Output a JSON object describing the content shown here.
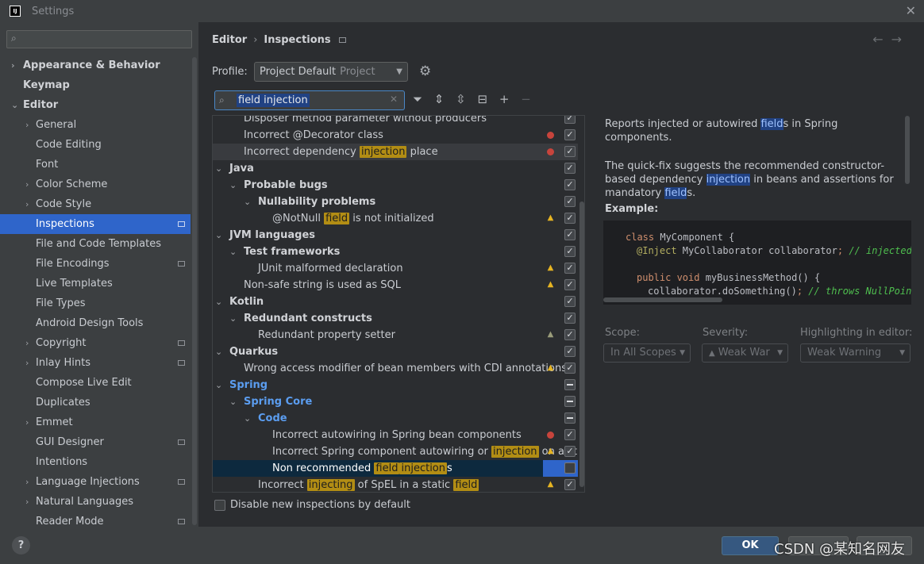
{
  "window": {
    "title": "Settings",
    "logo_text": "IJ"
  },
  "sidebar": {
    "items": [
      {
        "label": "Appearance & Behavior"
      },
      {
        "label": "Keymap"
      },
      {
        "label": "Editor"
      },
      {
        "label": "General"
      },
      {
        "label": "Code Editing"
      },
      {
        "label": "Font"
      },
      {
        "label": "Color Scheme"
      },
      {
        "label": "Code Style"
      },
      {
        "label": "Inspections"
      },
      {
        "label": "File and Code Templates"
      },
      {
        "label": "File Encodings"
      },
      {
        "label": "Live Templates"
      },
      {
        "label": "File Types"
      },
      {
        "label": "Android Design Tools"
      },
      {
        "label": "Copyright"
      },
      {
        "label": "Inlay Hints"
      },
      {
        "label": "Compose Live Edit"
      },
      {
        "label": "Duplicates"
      },
      {
        "label": "Emmet"
      },
      {
        "label": "GUI Designer"
      },
      {
        "label": "Intentions"
      },
      {
        "label": "Language Injections"
      },
      {
        "label": "Natural Languages"
      },
      {
        "label": "Reader Mode"
      }
    ]
  },
  "breadcrumb": {
    "parent": "Editor",
    "current": "Inspections"
  },
  "profile": {
    "label": "Profile:",
    "value": "Project Default",
    "scope": "Project"
  },
  "filter": {
    "value": "field injection"
  },
  "tree": {
    "rows": [
      {
        "pre": "Disposer method parameter without producers"
      },
      {
        "pre": "Incorrect @Decorator class"
      },
      {
        "pre": "Incorrect dependency ",
        "hl": "injection",
        "post": " place"
      },
      {
        "pre": "Java"
      },
      {
        "pre": "Probable bugs"
      },
      {
        "pre": "Nullability problems"
      },
      {
        "pre": "@NotNull ",
        "hl": "field",
        "post": " is not initialized"
      },
      {
        "pre": "JVM languages"
      },
      {
        "pre": "Test frameworks"
      },
      {
        "pre": "JUnit malformed declaration"
      },
      {
        "pre": "Non-safe string is used as SQL"
      },
      {
        "pre": "Kotlin"
      },
      {
        "pre": "Redundant constructs"
      },
      {
        "pre": "Redundant property setter"
      },
      {
        "pre": "Quarkus"
      },
      {
        "pre": "Wrong access modifier of bean members with CDI annotations"
      },
      {
        "pre": "Spring"
      },
      {
        "pre": "Spring Core"
      },
      {
        "pre": "Code"
      },
      {
        "pre": "Incorrect autowiring in Spring bean components"
      },
      {
        "pre": "Incorrect Spring component autowiring or ",
        "hl": "injection",
        "post": " on a st"
      },
      {
        "pre": "Non recommended ",
        "hl": "field",
        "hl2": "injection",
        "post": "s"
      },
      {
        "pre": "Incorrect ",
        "hl": "injecting",
        "mid": " of SpEL in a static ",
        "hl2": "field"
      }
    ],
    "disable_label": "Disable new inspections by default"
  },
  "description": {
    "p1_pre": "Reports injected or autowired ",
    "p1_hl": "field",
    "p1_post": "s in Spring components.",
    "p2_pre": "The quick-fix suggests the recommended constructor-based dependency ",
    "p2_hl": "injection",
    "p2_mid": " in beans and assertions for mandatory ",
    "p2_hl2": "field",
    "p2_post": "s.",
    "example_label": "Example:",
    "code": {
      "l1_kw": "class",
      "l1_rest": " MyComponent {",
      "l2_an": "@Inject",
      "l2_rest": " MyCollaborator collaborator",
      "l2_semi": ";",
      "l2_cm": " // injected f",
      "l3_kw": "public void",
      "l3_rest": " myBusinessMethod() {",
      "l4_rest": "collaborator.doSomething()",
      "l4_semi": ";",
      "l4_cm": " // throws NullPointe"
    }
  },
  "options": {
    "scope_label": "Scope:",
    "scope_value": "In All Scopes",
    "severity_label": "Severity:",
    "severity_value": "Weak War",
    "highlight_label": "Highlighting in editor:",
    "highlight_value": "Weak Warning"
  },
  "buttons": {
    "help": "?",
    "ok": "OK"
  },
  "watermark": "CSDN @某知名网友",
  "colors": {
    "accent": "#2f65ca",
    "highlight": "#b28d14",
    "warning": "#e6b422",
    "error": "#c7443c",
    "spring": "#5b9df0"
  }
}
